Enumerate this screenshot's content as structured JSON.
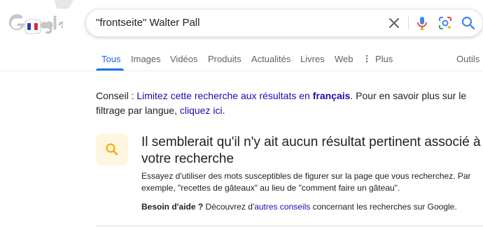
{
  "search": {
    "query": "\"frontseite\" Walter Pall"
  },
  "tabs": [
    {
      "label": "Tous"
    },
    {
      "label": "Images"
    },
    {
      "label": "Vidéos"
    },
    {
      "label": "Produits"
    },
    {
      "label": "Actualités"
    },
    {
      "label": "Livres"
    },
    {
      "label": "Web"
    },
    {
      "label": "Plus"
    }
  ],
  "tools_label": "Outils",
  "conseil": {
    "prefix": "Conseil : ",
    "link_part1": "Limitez cette recherche aux résultats en ",
    "link_bold": "français",
    "suffix": ". Pour en savoir plus sur le filtrage par langue, ",
    "link2": "cliquez ici",
    "end": "."
  },
  "no_results": {
    "title": "Il semblerait qu'il n'y ait aucun résultat pertinent associé à votre recherche",
    "advice": "Essayez d'utiliser des mots susceptibles de figurer sur la page que vous recherchez. Par exemple, \"recettes de gâteaux\" au lieu de \"comment faire un gâteau\".",
    "help_bold": "Besoin d'aide ?",
    "help_text": " Découvrez d'",
    "help_link": "autres conseils",
    "help_end": " concernant les recherches sur Google."
  },
  "colors": {
    "link": "#1a0dab",
    "active_tab": "#1967d2",
    "tip_bg": "#fef7e0",
    "tip_icon": "#f9ab00"
  }
}
